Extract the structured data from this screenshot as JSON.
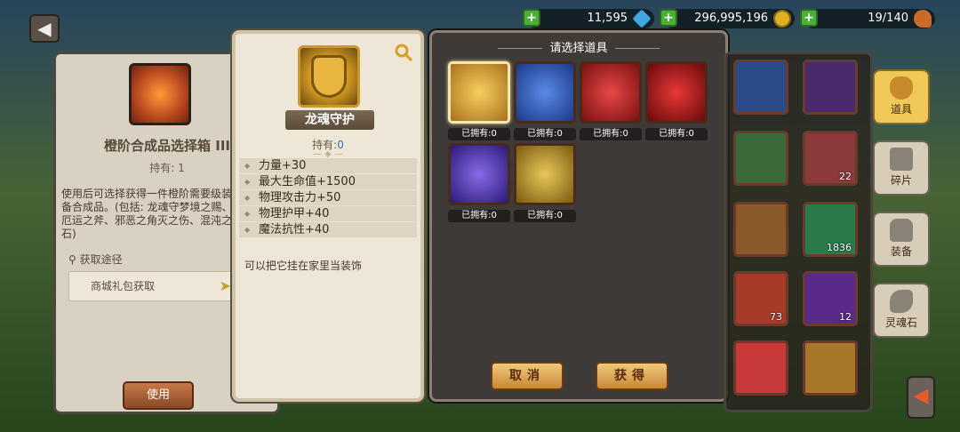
{
  "top_bar": {
    "back_label": "◀",
    "resources": [
      {
        "name": "diamonds",
        "value": "11,595",
        "color": "#3fa7e0"
      },
      {
        "name": "gold",
        "value": "296,995,196",
        "color": "#e0b020"
      },
      {
        "name": "stamina",
        "value": "19/140",
        "color": "#c86a2a"
      }
    ],
    "plus_label": "+"
  },
  "left_panel": {
    "title": "橙阶合成品选择箱 III",
    "own": "持有: 1",
    "description": "使用后可选择获得一件橙阶需要级装备合成品。(包括: 龙魂守梦境之赐、厄运之斧、邪恶之角灭之伤、混沌之石)",
    "source_title": "获取途径",
    "source_item": "商城礼包获取",
    "source_arrow": "➤",
    "use_button": "使用"
  },
  "detail_panel": {
    "item_name": "龙魂守护",
    "own_label": "持有:",
    "own_value": "0",
    "stats": [
      "力量+30",
      "最大生命值+1500",
      "物理攻击力+50",
      "物理护甲+40",
      "魔法抗性+40"
    ],
    "flavor": "可以把它挂在家里当装饰"
  },
  "select_panel": {
    "title": "请选择道具",
    "items": [
      {
        "name": "dragon-soul-shield",
        "label": "已拥有:0",
        "color": "#d8a830",
        "selected": true
      },
      {
        "name": "dream-gift-ring",
        "label": "已拥有:0",
        "color": "#2a5ab8",
        "selected": false
      },
      {
        "name": "doom-axe",
        "label": "已拥有:0",
        "color": "#c82020",
        "selected": false
      },
      {
        "name": "evil-horn",
        "label": "已拥有:0",
        "color": "#b81818",
        "selected": false
      },
      {
        "name": "destruction-blade",
        "label": "已拥有:0",
        "color": "#5a3ab8",
        "selected": false
      },
      {
        "name": "chaos-stone",
        "label": "已拥有:0",
        "color": "#c88a18",
        "selected": false
      }
    ],
    "cancel_button": "取消",
    "obtain_button": "获得"
  },
  "inventory": {
    "items": [
      {
        "color": "#2a4a8a",
        "count": ""
      },
      {
        "color": "#4a2a6a",
        "count": ""
      },
      {
        "color": "#3a6a3a",
        "count": ""
      },
      {
        "color": "#8a3a3a",
        "count": "22"
      },
      {
        "color": "#8a5a2a",
        "count": ""
      },
      {
        "color": "#2a7a4a",
        "count": "1836"
      },
      {
        "color": "#a83a2a",
        "count": "73"
      },
      {
        "color": "#5a2a8a",
        "count": "12"
      },
      {
        "color": "#c83a3a",
        "count": ""
      },
      {
        "color": "#a8782a",
        "count": ""
      }
    ]
  },
  "tabs": [
    {
      "label": "道具",
      "icon": "bag-icon",
      "active": true
    },
    {
      "label": "碎片",
      "icon": "puzzle-icon",
      "active": false
    },
    {
      "label": "装备",
      "icon": "armor-icon",
      "active": false
    },
    {
      "label": "灵魂石",
      "icon": "soulstone-icon",
      "active": false
    }
  ],
  "scroll_arrow": "◀"
}
